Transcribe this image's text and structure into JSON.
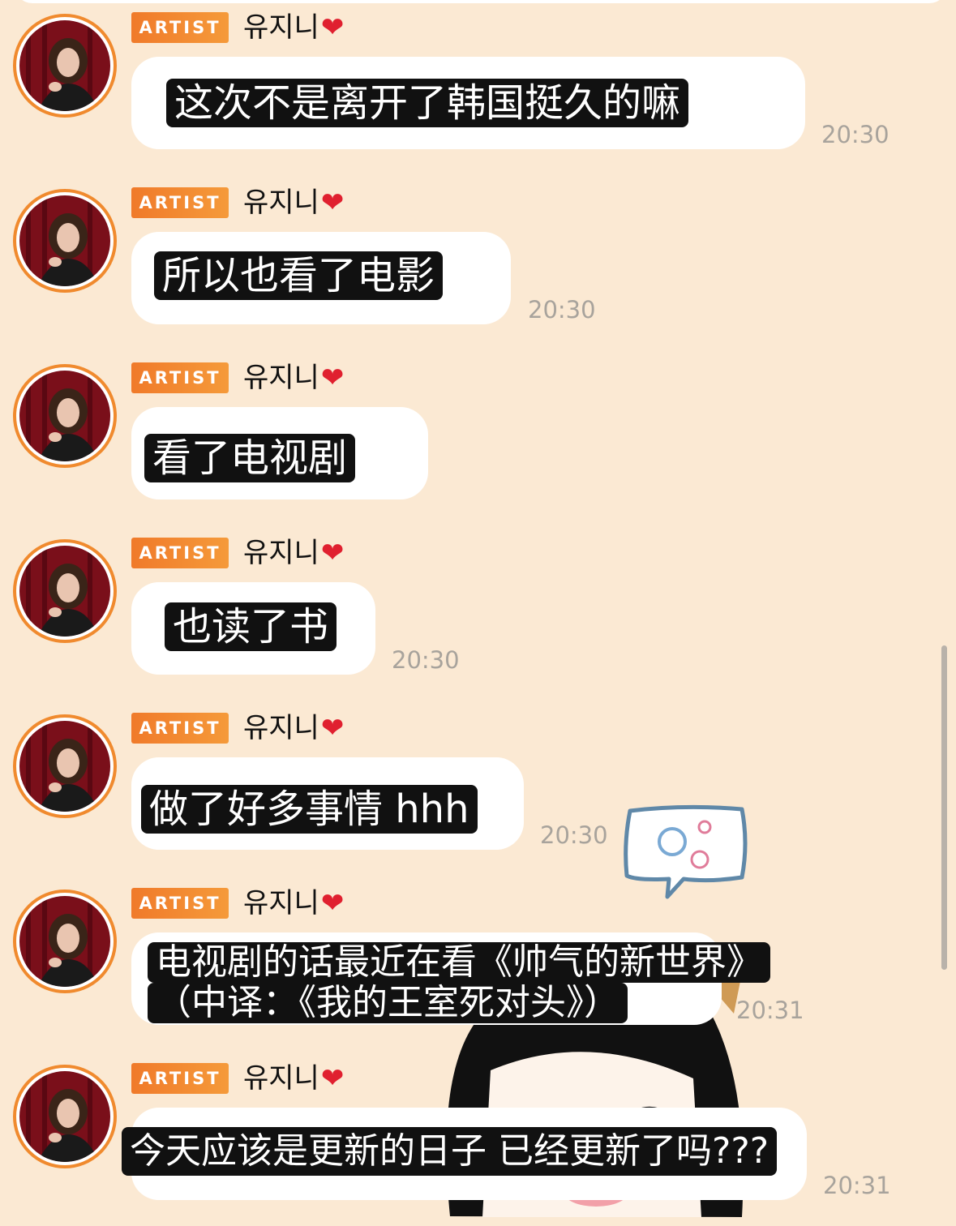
{
  "chat": {
    "messages": [
      {
        "badge": "ARTIST",
        "sender": "유지니",
        "text": "这次不是离开了韩国挺久的嘛",
        "time": "20:30"
      },
      {
        "badge": "ARTIST",
        "sender": "유지니",
        "text": "所以也看了电影",
        "time": "20:30"
      },
      {
        "badge": "ARTIST",
        "sender": "유지니",
        "text": "看了电视剧",
        "time": ""
      },
      {
        "badge": "ARTIST",
        "sender": "유지니",
        "text": "也读了书",
        "time": "20:30"
      },
      {
        "badge": "ARTIST",
        "sender": "유지니",
        "text": "做了好多事情 hhh",
        "time": "20:30"
      },
      {
        "badge": "ARTIST",
        "sender": "유지니",
        "text_line1": "电视剧的话最近在看《帅气的新世界》",
        "text_line2": "（中译：《我的王室死对头》）",
        "time": "20:31"
      },
      {
        "badge": "ARTIST",
        "sender": "유지니",
        "text": "今天应该是更新的日子 已经更新了吗???",
        "time": "20:31"
      }
    ]
  },
  "colors": {
    "background": "#fbe9d3",
    "badge": "#f07a2a",
    "avatar_ring": "#f08a2e",
    "bubble": "#ffffff",
    "caption": "#111111",
    "time": "#a8a39c",
    "heart": "#e0202f"
  },
  "icons": [
    "heart-icon",
    "avatar",
    "speech-bubble-sticker-icon",
    "character-sticker"
  ]
}
